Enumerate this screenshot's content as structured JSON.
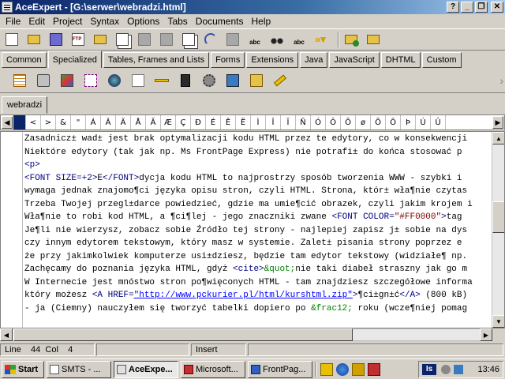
{
  "window": {
    "title": "AceExpert - [G:\\serwer\\webradzi.html]",
    "controls": {
      "help": "?",
      "minimize": "_",
      "restore": "❐",
      "close": "✕"
    }
  },
  "menu": [
    "File",
    "Edit",
    "Project",
    "Syntax",
    "Options",
    "Tabs",
    "Documents",
    "Help"
  ],
  "toolbar_tabs": [
    "Common",
    "Specialized",
    "Tables, Frames and Lists",
    "Forms",
    "Extensions",
    "Java",
    "JavaScript",
    "DHTML",
    "Custom"
  ],
  "active_toolbar_tab": "Specialized",
  "document_tab": "webradzi",
  "char_bar": {
    "left_arrow": "◀",
    "right_arrow": "▶",
    "chars": [
      "<",
      ">",
      "&",
      "\"",
      "Á",
      "Â",
      "Ä",
      "Å",
      "Ã",
      "Æ",
      "Ç",
      "Ð",
      "É",
      "Ê",
      "Ë",
      "Ì",
      "Î",
      "Ï",
      "Ñ",
      "Ó",
      "Ô",
      "Õ",
      "ø",
      "Õ",
      "Ö",
      "Þ",
      "Ú",
      "Û"
    ]
  },
  "editor": {
    "lines": [
      [
        {
          "t": "text",
          "v": "Zasadnicz± wad± jest brak optymalizacji kodu HTML przez te edytory, co w konsekwencji"
        }
      ],
      [
        {
          "t": "text",
          "v": "Niektóre edytory (tak jak np. Ms FrontPage Express) nie potrafi± do końca stosować p"
        }
      ],
      [
        {
          "t": "tag",
          "v": "<p>"
        }
      ],
      [
        {
          "t": "tag",
          "v": "<FONT SIZE=+2>"
        },
        {
          "t": "text",
          "v": "E"
        },
        {
          "t": "tag",
          "v": "</FONT>"
        },
        {
          "t": "text",
          "v": "dycja kodu HTML to najprostrzy sposób tworzenia WWW - szybki i"
        }
      ],
      [
        {
          "t": "text",
          "v": "wymaga jednak znajomo¶ci języka opisu stron, czyli HTML. Strona, któr± wła¶nie czytas"
        }
      ],
      [
        {
          "t": "text",
          "v": "Trzeba Twojej przegl±darce powiedzieć, gdzie ma umie¶cić obrazek, czyli jakim krojem i"
        }
      ],
      [
        {
          "t": "text",
          "v": "Wła¶nie to robi kod HTML, a ¶ci¶lej - jego znaczniki zwane "
        },
        {
          "t": "tag",
          "v": "<FONT COLOR="
        },
        {
          "t": "attr",
          "v": "\"#FF0000\""
        },
        {
          "t": "tag",
          "v": ">"
        },
        {
          "t": "text",
          "v": "tag"
        }
      ],
      [
        {
          "t": "text",
          "v": "Je¶li nie wierzysz, zobacz sobie Źródło tej strony - najlepiej zapisz j± sobie na dys"
        }
      ],
      [
        {
          "t": "text",
          "v": "czy innym edytorem tekstowym, który masz w systemie. Zalet± pisania strony poprzez e"
        }
      ],
      [
        {
          "t": "text",
          "v": "że przy jakimkolwiek komputerze usi±dziesz, będzie tam edytor tekstowy (widziałe¶ np."
        }
      ],
      [
        {
          "t": "text",
          "v": "Zachęcamy do poznania języka HTML, gdyż "
        },
        {
          "t": "tag",
          "v": "<cite>"
        },
        {
          "t": "ent",
          "v": "&quot;"
        },
        {
          "t": "text",
          "v": "nie taki diabeł straszny jak go m"
        }
      ],
      [
        {
          "t": "text",
          "v": "W Internecie jest mnóstwo stron po¶więconych HTML - tam znajdziesz szczegółowe informa"
        }
      ],
      [
        {
          "t": "text",
          "v": "który możesz "
        },
        {
          "t": "tag",
          "v": "<A HREF="
        },
        {
          "t": "link",
          "v": "\"http://www.pckurier.pl/html/kurshtml.zip\""
        },
        {
          "t": "tag",
          "v": ">"
        },
        {
          "t": "text",
          "v": "¶ci±gn±ć"
        },
        {
          "t": "tag",
          "v": "</A>"
        },
        {
          "t": "text",
          "v": " (800 kB)"
        }
      ],
      [
        {
          "t": "text",
          "v": "- ja (Ciemny) nauczyłem się tworzyć tabelki dopiero po "
        },
        {
          "t": "ent",
          "v": "&frac12;"
        },
        {
          "t": "text",
          "v": " roku (wcze¶niej pomag"
        }
      ]
    ]
  },
  "status": {
    "line_label": "Line",
    "line": "44",
    "col_label": "Col",
    "col": "4",
    "mode": "Insert"
  },
  "taskbar": {
    "start": "Start",
    "buttons": [
      {
        "label": "SMTS - ...",
        "active": false
      },
      {
        "label": "AceExpe...",
        "active": true
      },
      {
        "label": "Microsoft...",
        "active": false
      },
      {
        "label": "FrontPag...",
        "active": false
      }
    ],
    "tray_lang": "Is",
    "clock": "13:46"
  },
  "colors": {
    "titlebar": "#0a246a",
    "face": "#d4d0c8",
    "tag": "#000080",
    "link": "#0000ff"
  }
}
